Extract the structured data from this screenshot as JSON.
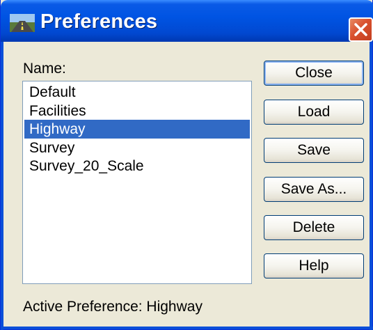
{
  "window": {
    "title": "Preferences"
  },
  "icons": {
    "app": "highway-road-icon",
    "close": "close-icon"
  },
  "colors": {
    "titlebar": "#0054e3",
    "selection": "#316ac5",
    "dialog_bg": "#ece9d8",
    "close_button": "#d9512e"
  },
  "name_label": "Name:",
  "preferences_list": {
    "items": [
      "Default",
      "Facilities",
      "Highway",
      "Survey",
      "Survey_20_Scale"
    ],
    "selected": "Highway"
  },
  "buttons": {
    "close": "Close",
    "load": "Load",
    "save": "Save",
    "save_as": "Save As...",
    "delete": "Delete",
    "help": "Help"
  },
  "status": {
    "active_preference": "Active Preference: Highway"
  }
}
